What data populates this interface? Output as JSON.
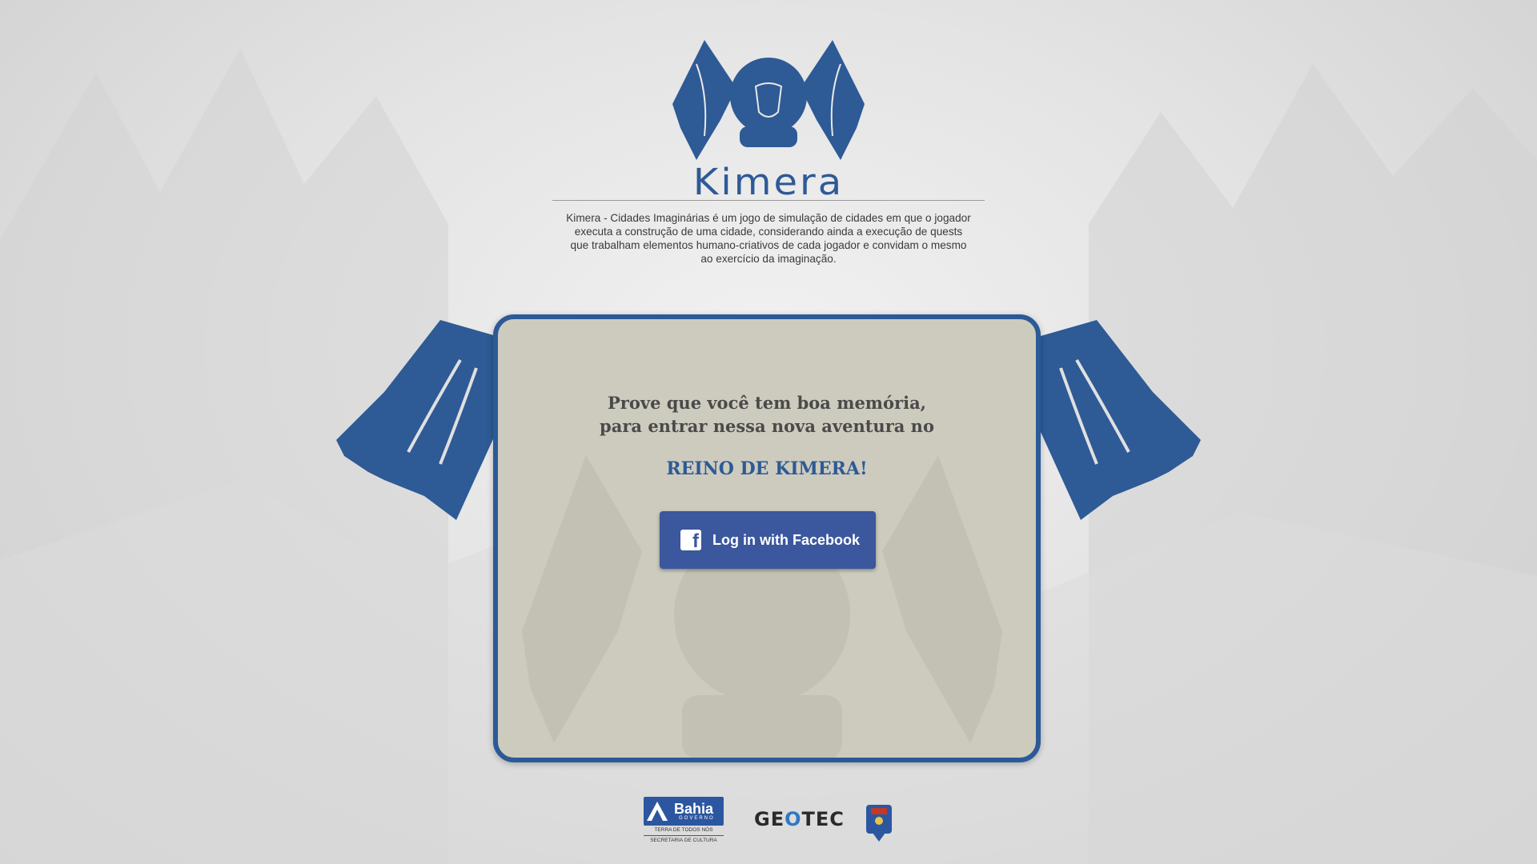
{
  "logo": {
    "name": "Kimera",
    "icon": "dragon-crest-icon"
  },
  "intro": {
    "description": "Kimera - Cidades Imaginárias é um jogo de simulação de cidades em que o jogador executa a construção de uma cidade, considerando ainda a execução de quests que trabalham elementos humano-criativos de cada jogador e convidam o mesmo ao exercício da imaginação."
  },
  "login_card": {
    "title_line1": "Prove que você tem boa memória,",
    "title_line2": "para entrar nessa nova aventura no",
    "kingdom": "REINO DE KIMERA!",
    "facebook_button": {
      "label": "Log in with Facebook",
      "icon": "facebook-icon"
    }
  },
  "sponsors": {
    "bahia": {
      "name": "Bahia",
      "sub": "GOVERNO",
      "tagline": "TERRA DE TODOS NÓS",
      "department": "SECRETARIA DE CULTURA"
    },
    "geotec": {
      "name_part1": "GE",
      "name_part2": "O",
      "name_part3": "TEC"
    },
    "uneb": {
      "icon": "university-crest-icon"
    }
  },
  "colors": {
    "brand_blue": "#2c5a97",
    "facebook_blue": "#3b579d",
    "card_bg": "#cdcbbe"
  }
}
